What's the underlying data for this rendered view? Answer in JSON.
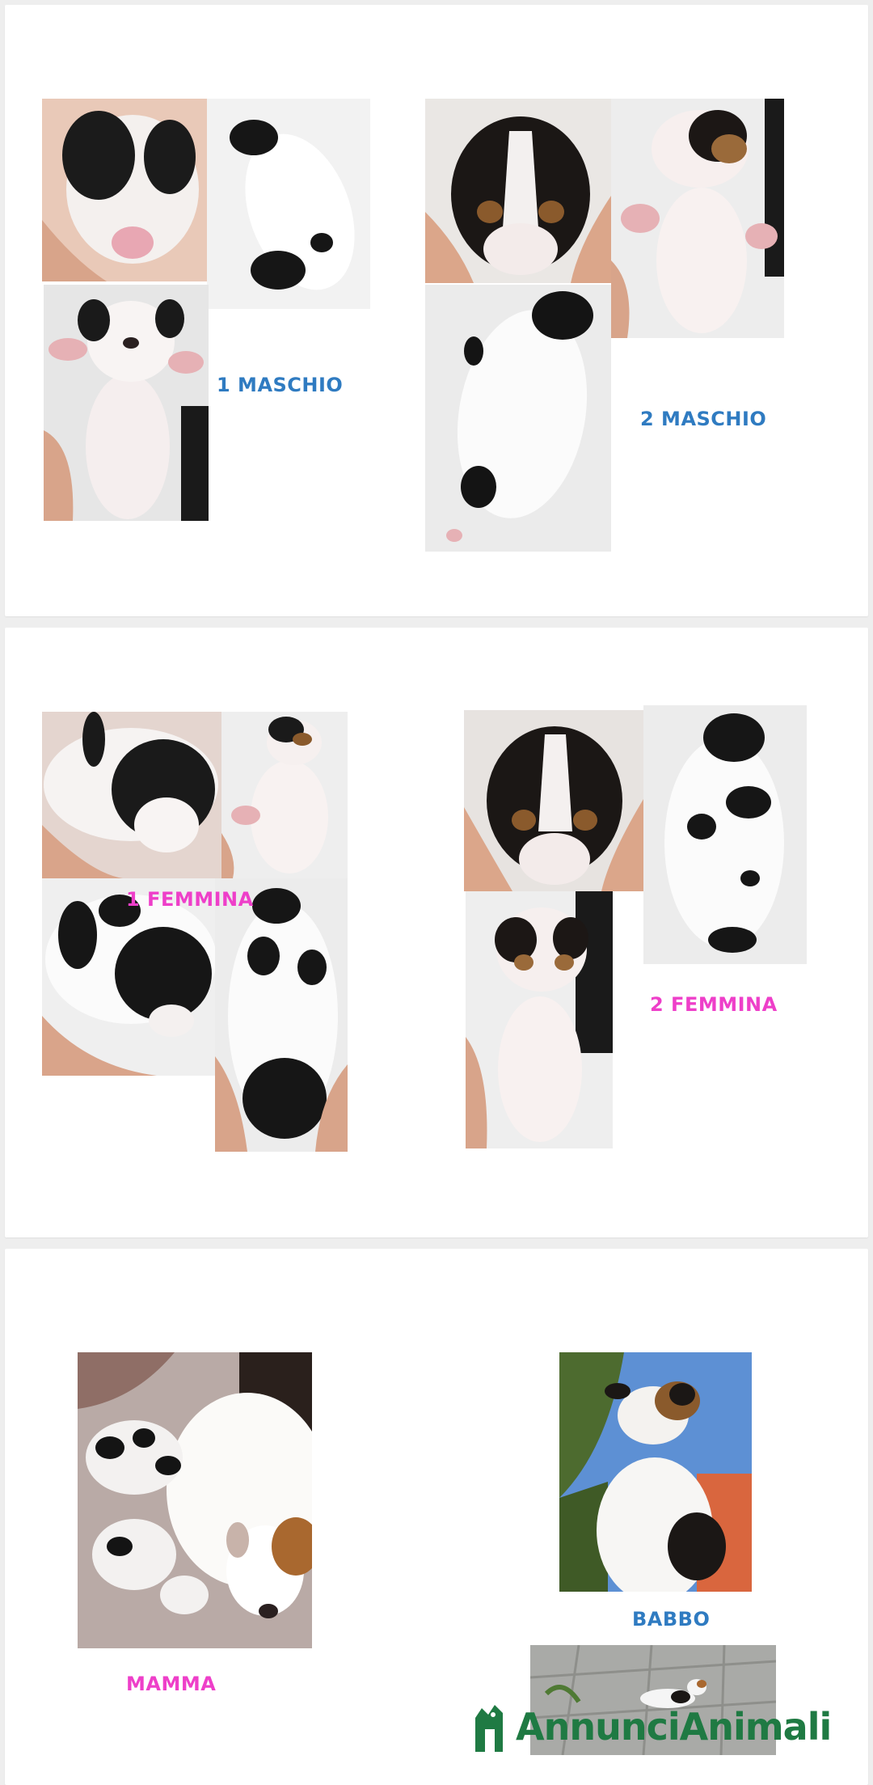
{
  "colors": {
    "label_blue": "#2f7bc1",
    "label_pink": "#ee3fc9",
    "logo_green": "#1f7a43",
    "card_background": "#ffffff",
    "page_background": "#eeeeee"
  },
  "section_males": {
    "male_1_label": "1 MASCHIO",
    "male_2_label": "2 MASCHIO"
  },
  "section_females": {
    "female_1_label": "1 FEMMINA",
    "female_2_label": "2 FEMMINA"
  },
  "section_parents": {
    "mother_label": "MAMMA",
    "father_label": "BABBO"
  },
  "watermark": {
    "brand": "AnnunciAnimali",
    "icon": "dog-logo-icon"
  }
}
